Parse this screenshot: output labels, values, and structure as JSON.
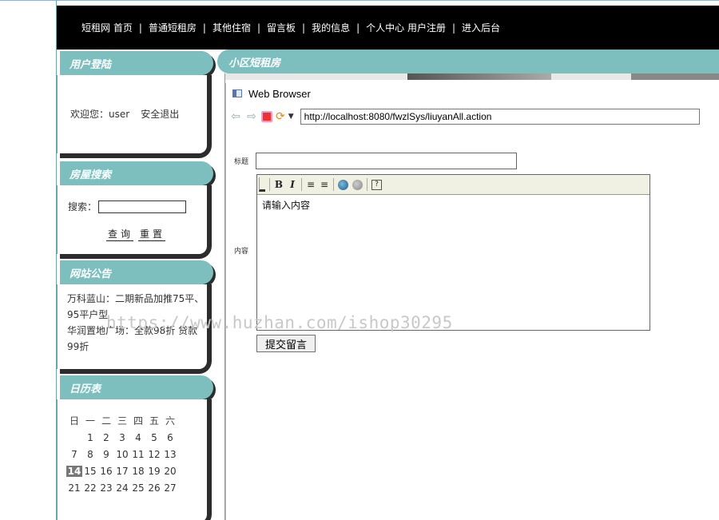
{
  "nav": {
    "items": [
      "短租网 首页",
      "普通短租房",
      "其他住宿",
      "留言板",
      "我的信息",
      "个人中心 用户注册",
      "进入后台"
    ],
    "separator": "|"
  },
  "login_panel": {
    "title": "用户登陆",
    "welcome": "欢迎您：user",
    "logout": "安全退出"
  },
  "search_panel": {
    "title": "房屋搜索",
    "label": "搜索：",
    "input_value": "",
    "query_button": "查询",
    "reset_button": "重置"
  },
  "notice_panel": {
    "title": "网站公告",
    "items": [
      "万科蓝山：二期新品加推75平、95平户型",
      "华润置地广场：全款98折 贷款99折"
    ]
  },
  "calendar_panel": {
    "title": "日历表",
    "weekdays": [
      "日",
      "一",
      "二",
      "三",
      "四",
      "五",
      "六"
    ],
    "weeks": [
      [
        "",
        "1",
        "2",
        "3",
        "4",
        "5",
        "6"
      ],
      [
        "7",
        "8",
        "9",
        "10",
        "11",
        "12",
        "13"
      ],
      [
        "14",
        "15",
        "16",
        "17",
        "18",
        "19",
        "20"
      ],
      [
        "21",
        "22",
        "23",
        "24",
        "25",
        "26",
        "27"
      ]
    ],
    "today": "14"
  },
  "main": {
    "title": "小区短租房"
  },
  "browser": {
    "window_title": "Web Browser",
    "address": "http://localhost:8080/fwzlSys/liuyanAll.action",
    "icons": {
      "back": "back-arrow-icon",
      "forward": "forward-arrow-icon",
      "stop": "stop-icon",
      "refresh": "refresh-icon",
      "dropdown": "dropdown-arrow-icon"
    }
  },
  "form": {
    "title_label": "标题",
    "title_value": "",
    "content_label": "内容",
    "editor_placeholder": "请输入内容",
    "toolbar": {
      "bold": "B",
      "italic": "I",
      "ordered_list": "≡",
      "unordered_list": "≡",
      "help": "?"
    },
    "submit": "提交留言"
  },
  "watermark": "https://www.huzhan.com/ishop30295",
  "colors": {
    "accent": "#7dbfbf",
    "nav_bg": "#000000",
    "shadow": "#2c2c2c"
  }
}
